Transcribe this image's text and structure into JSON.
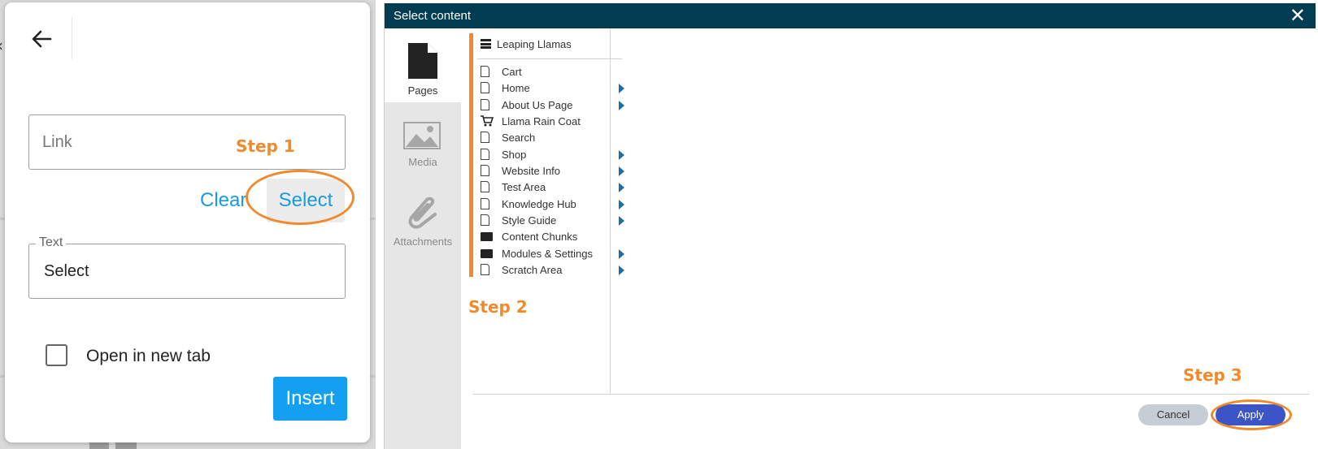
{
  "link_panel": {
    "link_placeholder": "Link",
    "clear_label": "Clear",
    "select_label": "Select",
    "text_legend": "Text",
    "text_value": "Select",
    "open_new_tab_label": "Open in new tab",
    "open_new_tab_checked": false,
    "insert_label": "Insert"
  },
  "annotations": {
    "step1": "Step 1",
    "step2": "Step 2",
    "step3": "Step 3",
    "highlight_color": "#f08a2c"
  },
  "dialog": {
    "title": "Select content",
    "close_icon": "close-icon",
    "type_tabs": [
      {
        "label": "Pages",
        "icon": "page-icon",
        "active": true
      },
      {
        "label": "Media",
        "icon": "image-icon",
        "active": false
      },
      {
        "label": "Attachments",
        "icon": "paperclip-icon",
        "active": false
      }
    ],
    "tree_root": {
      "label": "Leaping Llamas",
      "icon": "database-icon"
    },
    "tree_items": [
      {
        "label": "Cart",
        "icon": "page-icon",
        "has_children": false
      },
      {
        "label": "Home",
        "icon": "page-icon",
        "has_children": true
      },
      {
        "label": "About Us Page",
        "icon": "page-icon",
        "has_children": true
      },
      {
        "label": "Llama Rain Coat",
        "icon": "cart-icon",
        "has_children": false
      },
      {
        "label": "Search",
        "icon": "page-icon",
        "has_children": false
      },
      {
        "label": "Shop",
        "icon": "page-icon",
        "has_children": true
      },
      {
        "label": "Website Info",
        "icon": "page-icon",
        "has_children": true
      },
      {
        "label": "Test Area",
        "icon": "page-icon",
        "has_children": true
      },
      {
        "label": "Knowledge Hub",
        "icon": "page-icon",
        "has_children": true
      },
      {
        "label": "Style Guide",
        "icon": "page-icon",
        "has_children": true
      },
      {
        "label": "Content Chunks",
        "icon": "folder-icon",
        "has_children": false
      },
      {
        "label": "Modules & Settings",
        "icon": "folder-icon",
        "has_children": true
      },
      {
        "label": "Scratch Area",
        "icon": "page-icon",
        "has_children": true
      }
    ],
    "cancel_label": "Cancel",
    "apply_label": "Apply",
    "colors": {
      "titlebar": "#003d52",
      "apply": "#3b54c6",
      "cancel": "#c7cdd4",
      "link_accent": "#1a9be0",
      "insert": "#14a0f0"
    }
  }
}
